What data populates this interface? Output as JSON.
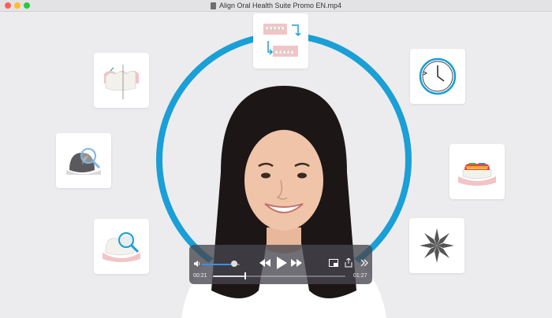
{
  "window": {
    "title": "Align Oral Health Suite Promo EN.mp4"
  },
  "colors": {
    "ring": "#1a9fd6",
    "close": "#fe5f57",
    "minimize": "#febc2e",
    "zoom": "#28c840",
    "tooth": "#f3f1ec",
    "gum": "#f2c4c6"
  },
  "icons": {
    "left_top": "tooth-gum-comparison-icon",
    "left_mid": "tooth-magnifier-icon",
    "left_bottom": "tooth-magnifier-pink-icon",
    "top": "teeth-arch-swap-icon",
    "right_top": "clock-icon",
    "right_mid": "rainbow-tooth-icon",
    "right_bottom": "sparkle-icon"
  },
  "player": {
    "current_time": "00:21",
    "total_time": "01:27",
    "progress": 0.241,
    "volume": 0.85
  }
}
